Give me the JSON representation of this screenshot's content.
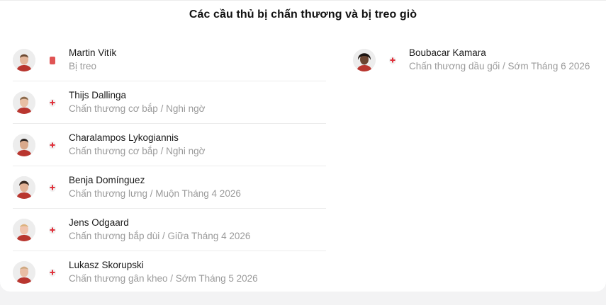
{
  "section": {
    "title": "Các cầu thủ bị chấn thương và bị treo giò"
  },
  "left_column": [
    {
      "name": "Martin Vitík",
      "detail": "Bị treo",
      "status": "red-card"
    },
    {
      "name": "Thijs Dallinga",
      "detail": "Chấn thương cơ bắp / Nghi ngờ",
      "status": "injury"
    },
    {
      "name": "Charalampos Lykogiannis",
      "detail": "Chấn thương cơ bắp / Nghi ngờ",
      "status": "injury"
    },
    {
      "name": "Benja Domínguez",
      "detail": "Chấn thương lưng / Muộn Tháng 4 2026",
      "status": "injury"
    },
    {
      "name": "Jens Odgaard",
      "detail": "Chấn thương bắp dùi / Giữa Tháng 4 2026",
      "status": "injury"
    },
    {
      "name": "Lukasz Skorupski",
      "detail": "Chấn thương gân kheo / Sớm Tháng 5 2026",
      "status": "injury"
    }
  ],
  "right_column": [
    {
      "name": "Boubacar Kamara",
      "detail": "Chấn thương dầu gối / Sớm Tháng 6 2026",
      "status": "injury"
    }
  ],
  "colors": {
    "red_card": "#e05454",
    "injury_cross": "#e0303a",
    "name_text": "#1a1a1a",
    "detail_text": "#9a9a9a"
  }
}
